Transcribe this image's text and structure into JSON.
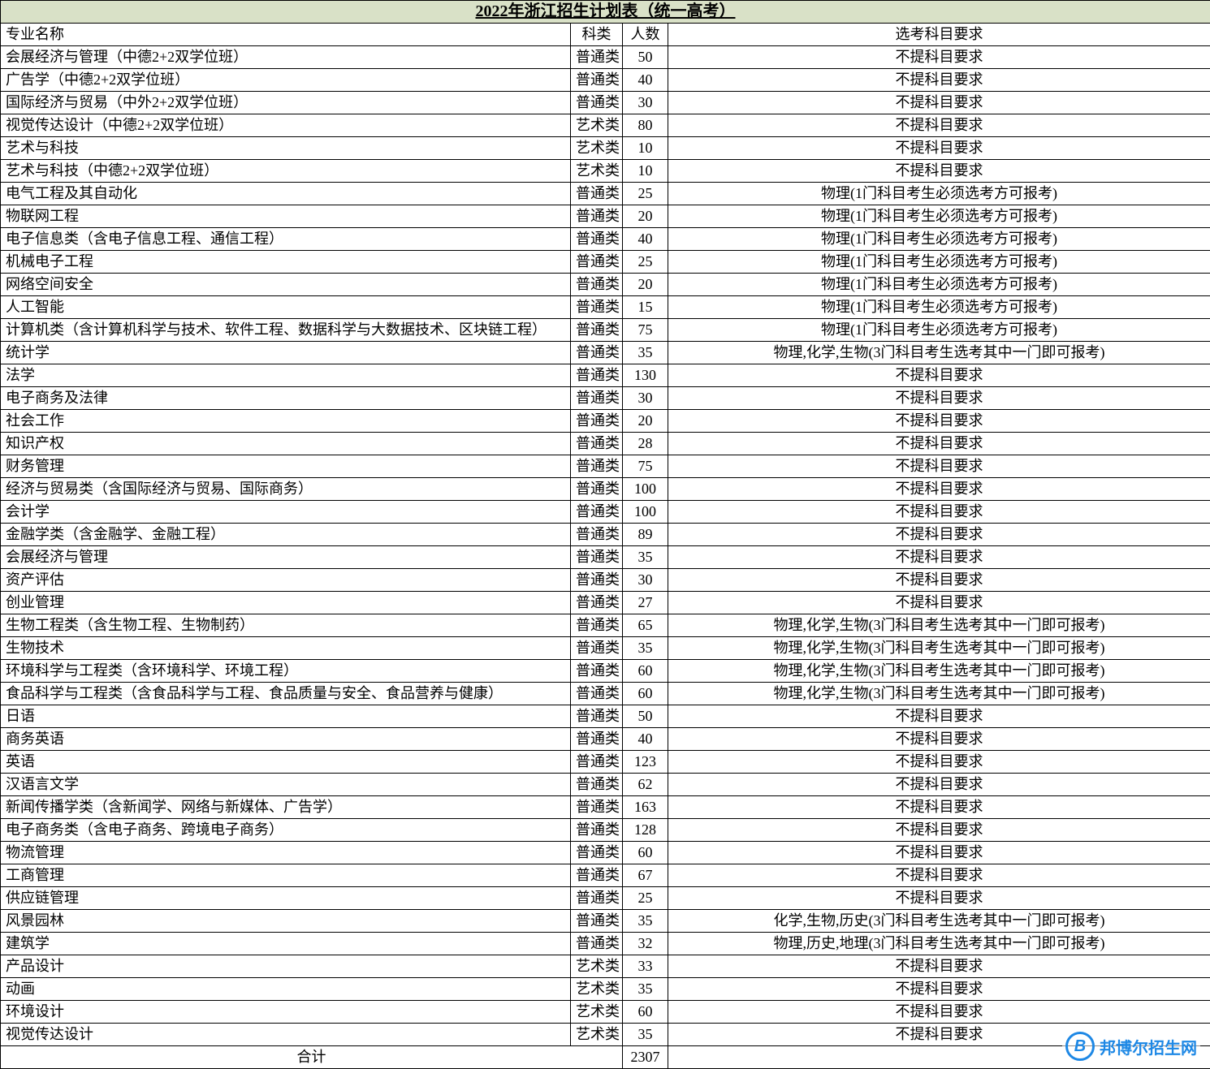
{
  "title": "2022年浙江招生计划表（统一高考）",
  "headers": {
    "major": "专业名称",
    "type": "科类",
    "count": "人数",
    "req": "选考科目要求"
  },
  "req_strings": {
    "none": "不提科目要求",
    "physics_must": "物理(1门科目考生必须选考方可报考)",
    "pcb_any": "物理,化学,生物(3门科目考生选考其中一门即可报考)",
    "cbh_any": "化学,生物,历史(3门科目考生选考其中一门即可报考)",
    "phg_any": "物理,历史,地理(3门科目考生选考其中一门即可报考)"
  },
  "rows": [
    {
      "major": "会展经济与管理（中德2+2双学位班）",
      "type": "普通类",
      "count": 50,
      "req": "none"
    },
    {
      "major": "广告学（中德2+2双学位班）",
      "type": "普通类",
      "count": 40,
      "req": "none"
    },
    {
      "major": "国际经济与贸易（中外2+2双学位班）",
      "type": "普通类",
      "count": 30,
      "req": "none"
    },
    {
      "major": "视觉传达设计（中德2+2双学位班）",
      "type": "艺术类",
      "count": 80,
      "req": "none"
    },
    {
      "major": "艺术与科技",
      "type": "艺术类",
      "count": 10,
      "req": "none"
    },
    {
      "major": "艺术与科技（中德2+2双学位班）",
      "type": "艺术类",
      "count": 10,
      "req": "none"
    },
    {
      "major": "电气工程及其自动化",
      "type": "普通类",
      "count": 25,
      "req": "physics_must"
    },
    {
      "major": "物联网工程",
      "type": "普通类",
      "count": 20,
      "req": "physics_must"
    },
    {
      "major": "电子信息类（含电子信息工程、通信工程）",
      "type": "普通类",
      "count": 40,
      "req": "physics_must"
    },
    {
      "major": "机械电子工程",
      "type": "普通类",
      "count": 25,
      "req": "physics_must"
    },
    {
      "major": "网络空间安全",
      "type": "普通类",
      "count": 20,
      "req": "physics_must"
    },
    {
      "major": "人工智能",
      "type": "普通类",
      "count": 15,
      "req": "physics_must"
    },
    {
      "major": "计算机类（含计算机科学与技术、软件工程、数据科学与大数据技术、区块链工程）",
      "type": "普通类",
      "count": 75,
      "req": "physics_must"
    },
    {
      "major": "统计学",
      "type": "普通类",
      "count": 35,
      "req": "pcb_any"
    },
    {
      "major": "法学",
      "type": "普通类",
      "count": 130,
      "req": "none"
    },
    {
      "major": "电子商务及法律",
      "type": "普通类",
      "count": 30,
      "req": "none"
    },
    {
      "major": "社会工作",
      "type": "普通类",
      "count": 20,
      "req": "none"
    },
    {
      "major": "知识产权",
      "type": "普通类",
      "count": 28,
      "req": "none"
    },
    {
      "major": "财务管理",
      "type": "普通类",
      "count": 75,
      "req": "none"
    },
    {
      "major": "经济与贸易类（含国际经济与贸易、国际商务）",
      "type": "普通类",
      "count": 100,
      "req": "none"
    },
    {
      "major": "会计学",
      "type": "普通类",
      "count": 100,
      "req": "none"
    },
    {
      "major": "金融学类（含金融学、金融工程）",
      "type": "普通类",
      "count": 89,
      "req": "none"
    },
    {
      "major": "会展经济与管理",
      "type": "普通类",
      "count": 35,
      "req": "none"
    },
    {
      "major": "资产评估",
      "type": "普通类",
      "count": 30,
      "req": "none"
    },
    {
      "major": "创业管理",
      "type": "普通类",
      "count": 27,
      "req": "none"
    },
    {
      "major": "生物工程类（含生物工程、生物制药）",
      "type": "普通类",
      "count": 65,
      "req": "pcb_any"
    },
    {
      "major": "生物技术",
      "type": "普通类",
      "count": 35,
      "req": "pcb_any"
    },
    {
      "major": "环境科学与工程类（含环境科学、环境工程）",
      "type": "普通类",
      "count": 60,
      "req": "pcb_any"
    },
    {
      "major": "食品科学与工程类（含食品科学与工程、食品质量与安全、食品营养与健康）",
      "type": "普通类",
      "count": 60,
      "req": "pcb_any"
    },
    {
      "major": "日语",
      "type": "普通类",
      "count": 50,
      "req": "none"
    },
    {
      "major": "商务英语",
      "type": "普通类",
      "count": 40,
      "req": "none"
    },
    {
      "major": "英语",
      "type": "普通类",
      "count": 123,
      "req": "none"
    },
    {
      "major": "汉语言文学",
      "type": "普通类",
      "count": 62,
      "req": "none"
    },
    {
      "major": "新闻传播学类（含新闻学、网络与新媒体、广告学）",
      "type": "普通类",
      "count": 163,
      "req": "none"
    },
    {
      "major": "电子商务类（含电子商务、跨境电子商务）",
      "type": "普通类",
      "count": 128,
      "req": "none"
    },
    {
      "major": "物流管理",
      "type": "普通类",
      "count": 60,
      "req": "none"
    },
    {
      "major": "工商管理",
      "type": "普通类",
      "count": 67,
      "req": "none"
    },
    {
      "major": "供应链管理",
      "type": "普通类",
      "count": 25,
      "req": "none"
    },
    {
      "major": "风景园林",
      "type": "普通类",
      "count": 35,
      "req": "cbh_any"
    },
    {
      "major": "建筑学",
      "type": "普通类",
      "count": 32,
      "req": "phg_any"
    },
    {
      "major": "产品设计",
      "type": "艺术类",
      "count": 33,
      "req": "none"
    },
    {
      "major": "动画",
      "type": "艺术类",
      "count": 35,
      "req": "none"
    },
    {
      "major": "环境设计",
      "type": "艺术类",
      "count": 60,
      "req": "none"
    },
    {
      "major": "视觉传达设计",
      "type": "艺术类",
      "count": 35,
      "req": "none"
    }
  ],
  "total": {
    "label": "合计",
    "value": 2307
  },
  "watermark": {
    "logo": "B",
    "text": "邦博尔招生网"
  }
}
